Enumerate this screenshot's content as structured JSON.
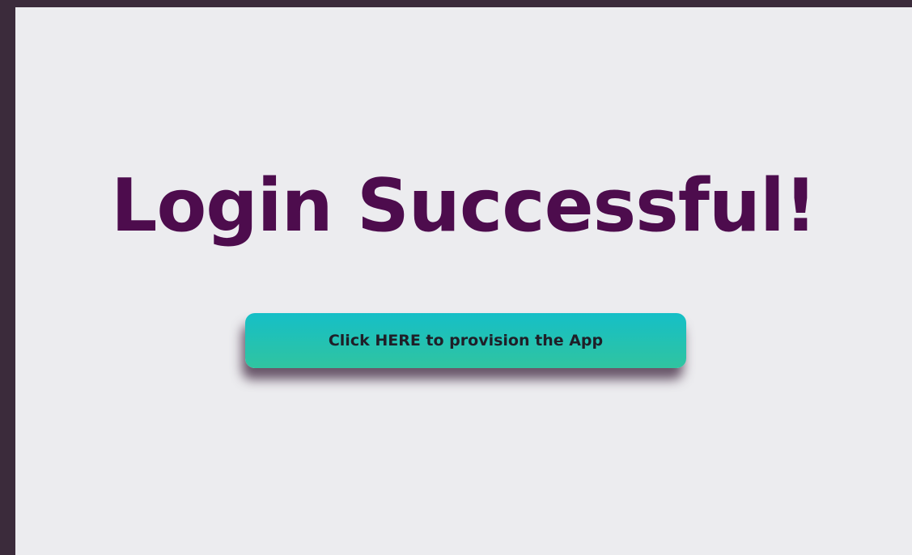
{
  "main": {
    "heading": "Login Successful!",
    "provision_button_label": "Click HERE to provision the App"
  },
  "colors": {
    "background_frame": "#3b2b3b",
    "panel": "#ececef",
    "heading": "#4d0c4d",
    "button_gradient_top": "#15bfc7",
    "button_gradient_bottom": "#30c4a0"
  }
}
